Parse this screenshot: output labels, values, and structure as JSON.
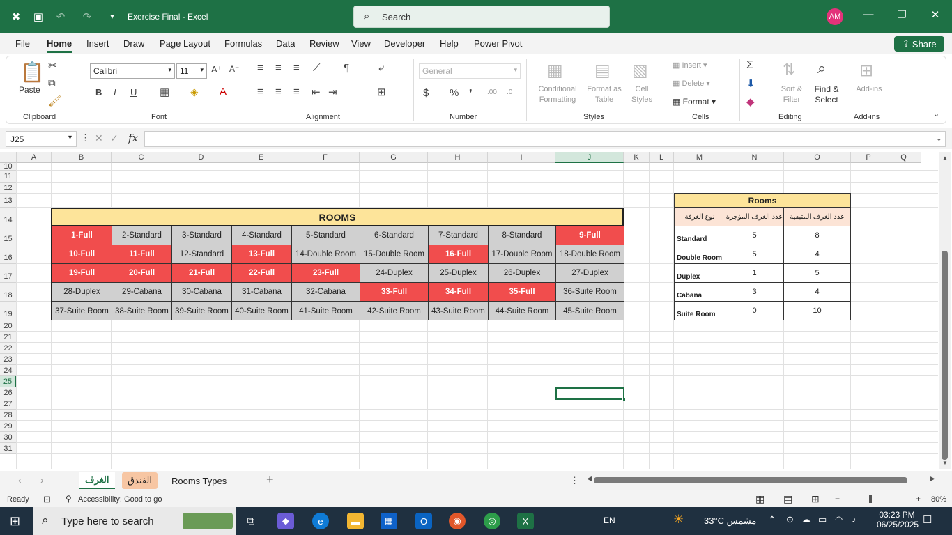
{
  "window": {
    "doc_title": "Exercise Final",
    "app_name": "Excel",
    "separator": "-"
  },
  "search": {
    "placeholder": "Search"
  },
  "user": {
    "initials": "AM"
  },
  "menu": [
    "File",
    "Home",
    "Insert",
    "Draw",
    "Page Layout",
    "Formulas",
    "Data",
    "Review",
    "View",
    "Developer",
    "Help",
    "Power Pivot"
  ],
  "share_label": "Share",
  "ribbon": {
    "clipboard": {
      "group": "Clipboard",
      "paste": "Paste"
    },
    "font": {
      "group": "Font",
      "name": "Calibri",
      "size": "11"
    },
    "alignment": {
      "group": "Alignment"
    },
    "number": {
      "group": "Number",
      "format": "General"
    },
    "styles": {
      "group": "Styles",
      "conditional": [
        "Conditional",
        "Formatting"
      ],
      "format_table": [
        "Format as",
        "Table"
      ],
      "cell_styles": [
        "Cell",
        "Styles"
      ]
    },
    "cells": {
      "group": "Cells",
      "insert": "Insert",
      "delete": "Delete",
      "format": "Format"
    },
    "editing": {
      "group": "Editing",
      "sort": [
        "Sort &",
        "Filter"
      ],
      "find": [
        "Find &",
        "Select"
      ]
    },
    "addins": {
      "group": "Add-ins",
      "label": "Add-ins"
    }
  },
  "formula_bar": {
    "name_box": "J25",
    "fx": "fx",
    "value": ""
  },
  "columns": [
    "A",
    "B",
    "C",
    "D",
    "E",
    "F",
    "G",
    "H",
    "I",
    "J",
    "K",
    "L",
    "M",
    "N",
    "O",
    "P",
    "Q"
  ],
  "rows": [
    "10",
    "11",
    "12",
    "13",
    "14",
    "15",
    "16",
    "17",
    "18",
    "19",
    "20",
    "21",
    "22",
    "23",
    "24",
    "25",
    "26",
    "27",
    "28",
    "29",
    "30",
    "31"
  ],
  "rooms_table": {
    "title": "ROOMS",
    "rows": [
      [
        {
          "t": "1-Full",
          "s": "full"
        },
        {
          "t": "2-Standard",
          "s": "avail"
        },
        {
          "t": "3-Standard",
          "s": "avail"
        },
        {
          "t": "4-Standard",
          "s": "avail"
        },
        {
          "t": "5-Standard",
          "s": "avail"
        },
        {
          "t": "6-Standard",
          "s": "avail"
        },
        {
          "t": "7-Standard",
          "s": "avail"
        },
        {
          "t": "8-Standard",
          "s": "avail"
        },
        {
          "t": "9-Full",
          "s": "full"
        }
      ],
      [
        {
          "t": "10-Full",
          "s": "full"
        },
        {
          "t": "11-Full",
          "s": "full"
        },
        {
          "t": "12-Standard",
          "s": "avail"
        },
        {
          "t": "13-Full",
          "s": "full"
        },
        {
          "t": "14-Double Room",
          "s": "avail"
        },
        {
          "t": "15-Double Room",
          "s": "avail"
        },
        {
          "t": "16-Full",
          "s": "full"
        },
        {
          "t": "17-Double Room",
          "s": "avail"
        },
        {
          "t": "18-Double Room",
          "s": "avail"
        }
      ],
      [
        {
          "t": "19-Full",
          "s": "full"
        },
        {
          "t": "20-Full",
          "s": "full"
        },
        {
          "t": "21-Full",
          "s": "full"
        },
        {
          "t": "22-Full",
          "s": "full"
        },
        {
          "t": "23-Full",
          "s": "full"
        },
        {
          "t": "24-Duplex",
          "s": "avail"
        },
        {
          "t": "25-Duplex",
          "s": "avail"
        },
        {
          "t": "26-Duplex",
          "s": "avail"
        },
        {
          "t": "27-Duplex",
          "s": "avail"
        }
      ],
      [
        {
          "t": "28-Duplex",
          "s": "avail"
        },
        {
          "t": "29-Cabana",
          "s": "avail"
        },
        {
          "t": "30-Cabana",
          "s": "avail"
        },
        {
          "t": "31-Cabana",
          "s": "avail"
        },
        {
          "t": "32-Cabana",
          "s": "avail"
        },
        {
          "t": "33-Full",
          "s": "full"
        },
        {
          "t": "34-Full",
          "s": "full"
        },
        {
          "t": "35-Full",
          "s": "full"
        },
        {
          "t": "36-Suite Room",
          "s": "avail"
        }
      ],
      [
        {
          "t": "37-Suite Room",
          "s": "avail"
        },
        {
          "t": "38-Suite Room",
          "s": "avail"
        },
        {
          "t": "39-Suite Room",
          "s": "avail"
        },
        {
          "t": "40-Suite Room",
          "s": "avail"
        },
        {
          "t": "41-Suite Room",
          "s": "avail"
        },
        {
          "t": "42-Suite Room",
          "s": "avail"
        },
        {
          "t": "43-Suite Room",
          "s": "avail"
        },
        {
          "t": "44-Suite Room",
          "s": "avail"
        },
        {
          "t": "45-Suite Room",
          "s": "avail"
        }
      ]
    ]
  },
  "summary_table": {
    "title": "Rooms",
    "headers": [
      "نوع الغرفة",
      "عدد الغرف المؤجرة",
      "عدد الغرف المتبقية"
    ],
    "rows": [
      [
        "Standard",
        "5",
        "8"
      ],
      [
        "Double Room",
        "5",
        "4"
      ],
      [
        "Duplex",
        "1",
        "5"
      ],
      [
        "Cabana",
        "3",
        "4"
      ],
      [
        "Suite Room",
        "0",
        "10"
      ]
    ]
  },
  "sheet_tabs": [
    "الغرف",
    "الفندق",
    "Rooms Types"
  ],
  "status": {
    "ready": "Ready",
    "accessibility": "Accessibility: Good to go",
    "zoom": "80%"
  },
  "taskbar": {
    "search": "Type here to search",
    "lang": "EN",
    "temp": "33°C",
    "weather": "مشمس",
    "time": "03:23 PM",
    "date": "06/25/2025"
  },
  "colors": {
    "excel_green": "#1e7145",
    "full": "#f14d4d",
    "available": "#d0d0d0",
    "title_fill": "#fde49a"
  }
}
